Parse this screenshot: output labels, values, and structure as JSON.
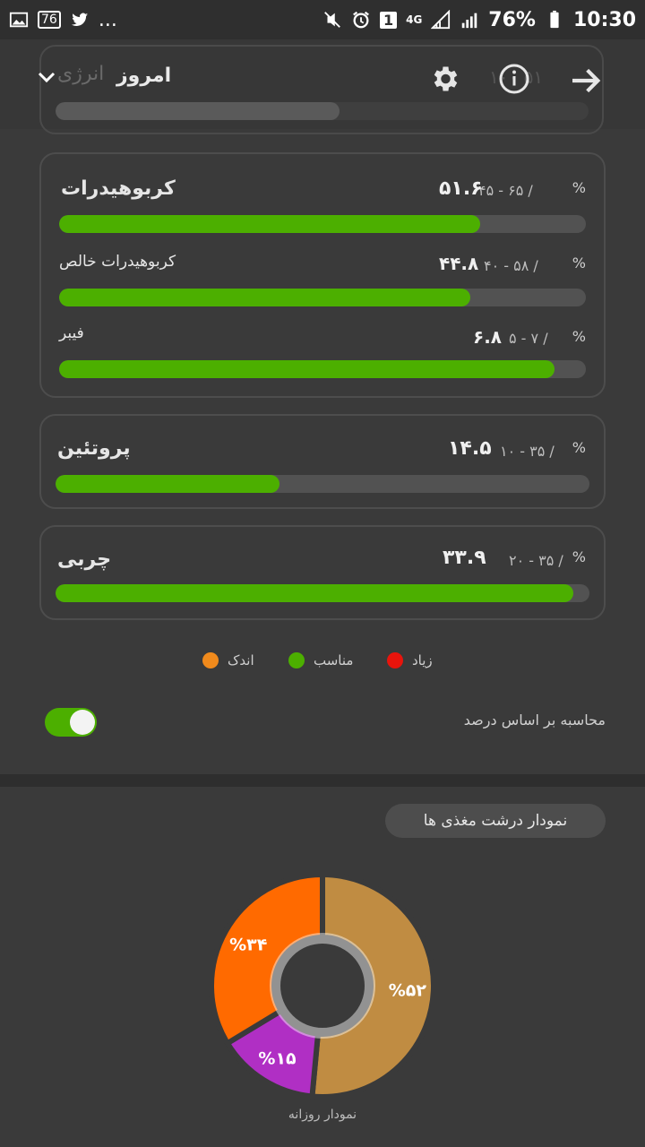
{
  "status_bar": {
    "left_icons": [
      "image-icon",
      "notification-count-icon",
      "twitter-icon"
    ],
    "notification_count": "76",
    "more": "...",
    "battery": "76%",
    "time": "10:30",
    "sim": "1",
    "network": "4G"
  },
  "toolbar": {
    "title": "امروز",
    "faded_title": "انرژی",
    "faded_value": "۱۰۰ ۵۱"
  },
  "carbs": {
    "label": "کربوهیدرات",
    "pct": "%",
    "range": "۴۵ - ۶۵ /",
    "value": "۵۱.۶",
    "fill": 0.8,
    "net": {
      "label": "کربوهیدرات خالص",
      "pct": "%",
      "range": "۴۰ - ۵۸ /",
      "value": "۴۴.۸",
      "fill": 0.78
    },
    "fiber": {
      "label": "فیبر",
      "pct": "%",
      "range": "۵ - ۷ /",
      "value": "۶.۸",
      "fill": 0.94
    }
  },
  "protein": {
    "label": "پروتئین",
    "pct": "%",
    "range": "۱۰ - ۳۵ /",
    "value": "۱۴.۵",
    "fill": 0.42
  },
  "fat": {
    "label": "چربی",
    "pct": "%",
    "range": "۲۰ - ۳۵ /",
    "value": "۳۳.۹",
    "fill": 0.97
  },
  "legend": {
    "low": "اندک",
    "ok": "مناسب",
    "high": "زیاد",
    "colors": {
      "low": "#f08a1c",
      "ok": "#4caf00",
      "high": "#e8140c"
    }
  },
  "toggle": {
    "label": "محاسبه بر اساس درصد",
    "on": true
  },
  "macro_chart_button": "نمودار درشت مغذی ها",
  "chart_caption": "نمودار روزانه",
  "chart_data": {
    "type": "pie",
    "slices": [
      {
        "label": "%۵۲",
        "value": 52,
        "color": "#c08c42"
      },
      {
        "label": "%۱۵",
        "value": 15,
        "color": "#b02fc4"
      },
      {
        "label": "%۳۴",
        "value": 34,
        "color": "#ff6a00"
      }
    ]
  }
}
